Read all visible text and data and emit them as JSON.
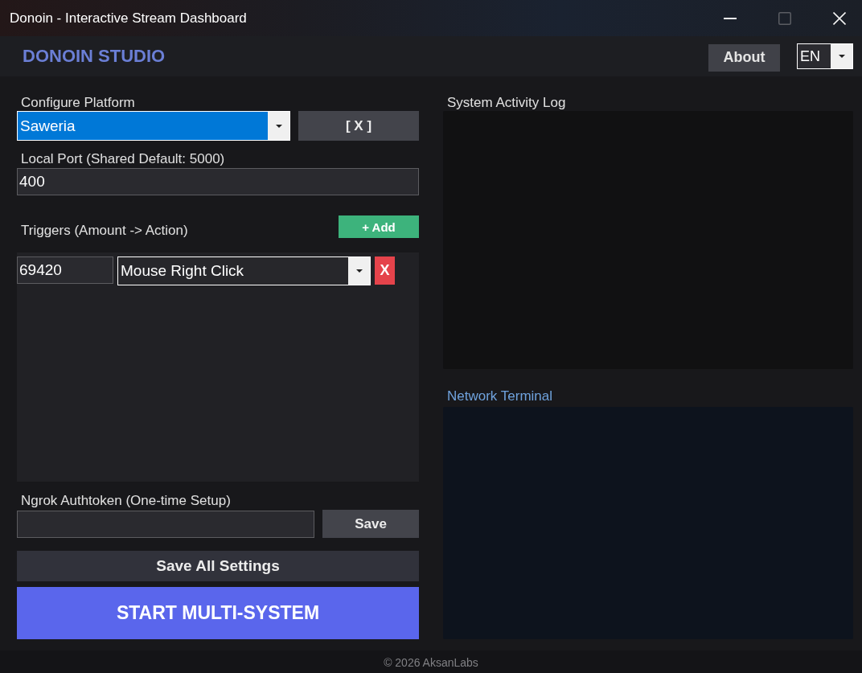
{
  "window": {
    "title": "Donoin - Interactive Stream Dashboard",
    "controls": [
      {
        "kind": "minimize",
        "disabled": false
      },
      {
        "kind": "maximize",
        "disabled": true
      },
      {
        "kind": "close",
        "disabled": false
      }
    ]
  },
  "header": {
    "brand": "DONOIN STUDIO",
    "about_button": "About",
    "language": {
      "value": "EN"
    }
  },
  "platform": {
    "label": "Configure Platform",
    "select": {
      "value": "Saweria",
      "focused": true
    },
    "clear_button": "[ X ]"
  },
  "port": {
    "label": "Local Port (Shared Default: 5000)",
    "value": "400"
  },
  "triggers": {
    "label": "Triggers (Amount -> Action)",
    "add_button": "+ Add",
    "rows": [
      {
        "amount": "69420",
        "action": "Mouse Right Click",
        "delete_button": "X"
      }
    ]
  },
  "ngrok": {
    "label": "Ngrok Authtoken (One-time Setup)",
    "save_button": "Save"
  },
  "save_all_button": "Save All Settings",
  "start_button": "START MULTI-SYSTEM",
  "activity_log": {
    "label": "System Activity Log"
  },
  "terminal": {
    "label": "Network Terminal"
  },
  "footer": "© 2026 AksanLabs"
}
